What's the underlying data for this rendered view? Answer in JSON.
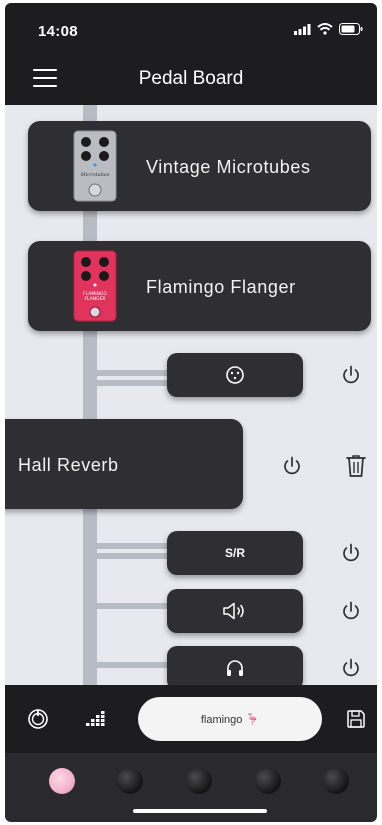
{
  "status": {
    "time": "14:08"
  },
  "header": {
    "title": "Pedal Board"
  },
  "pedals": [
    {
      "name": "Vintage Microtubes",
      "pedal_color": "#b9bcc1",
      "brand": "Microtubes"
    },
    {
      "name": "Flamingo Flanger",
      "pedal_color": "#e0345c",
      "brand": "FLAMINGO FLANGER"
    },
    {
      "name": "Hall Reverb"
    }
  ],
  "slots": {
    "sr_label": "S/R"
  },
  "bottom": {
    "preset_name": "flamingo 🦩"
  },
  "colors": {
    "accent_pink": "#f4b6cf",
    "card": "#2f2f33",
    "bar": "#1d1d20",
    "cable": "#b7bbc3"
  }
}
